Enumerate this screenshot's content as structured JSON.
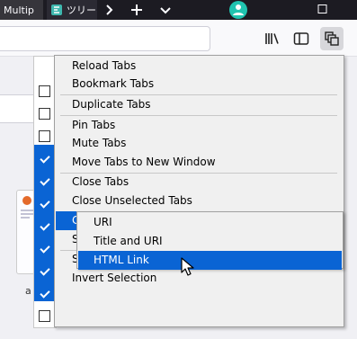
{
  "tabs": [
    {
      "label": "Multip"
    },
    {
      "label": "ツリー"
    }
  ],
  "context_menu": {
    "items": [
      {
        "label": "Reload Tabs"
      },
      {
        "label": "Bookmark Tabs"
      },
      {
        "label": "Duplicate Tabs"
      },
      {
        "label": "Pin Tabs"
      },
      {
        "label": "Mute Tabs"
      },
      {
        "label": "Move Tabs to New Window"
      },
      {
        "label": "Close Tabs"
      },
      {
        "label": "Close Unselected Tabs"
      },
      {
        "label": "C"
      },
      {
        "label": "S"
      },
      {
        "label": "S"
      },
      {
        "label": "Invert Selection"
      }
    ],
    "active_index": 8
  },
  "copy_submenu": {
    "items": [
      {
        "label": "URI"
      },
      {
        "label": "Title and URI"
      },
      {
        "label": "HTML Link"
      }
    ],
    "highlighted_index": 2
  },
  "checkboxes": [
    false,
    false,
    false,
    true,
    true,
    true,
    true,
    true,
    true,
    true,
    false
  ],
  "page": {
    "thumbnail_caption": "a"
  },
  "icons": {
    "tab_a": "favicon",
    "tab_b": "tree-style-tab-icon",
    "scroll_right": "chevron-right-icon",
    "new_tab": "plus-icon",
    "all_tabs": "chevron-down-icon",
    "account": "account-avatar-icon",
    "restore": "window-restore-icon",
    "library": "library-icon",
    "sidebar": "sidebar-icon",
    "multitab": "multiple-tabs-icon"
  },
  "colors": {
    "selection": "#0a64d4",
    "titlebar": "#1c1b22"
  }
}
